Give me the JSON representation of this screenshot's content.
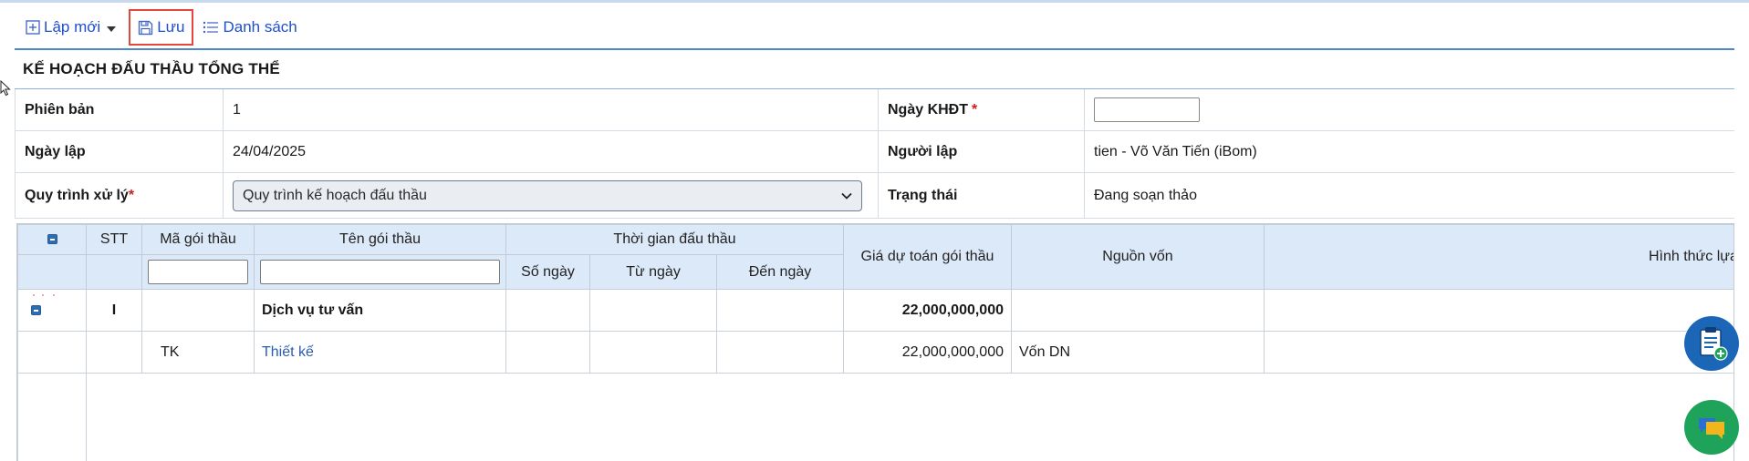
{
  "toolbar": {
    "new_label": "Lập mới",
    "save_label": "Lưu",
    "list_label": "Danh sách"
  },
  "page": {
    "title": "KẾ HOẠCH ĐẤU THẦU TỔNG THỂ"
  },
  "info": {
    "version_label": "Phiên bản",
    "version_value": "1",
    "plan_date_label": "Ngày KHĐT",
    "plan_date_value": "",
    "created_date_label": "Ngày lập",
    "created_date_value": "24/04/2025",
    "creator_label": "Người lập",
    "creator_value": "tien - Võ Văn Tiến (iBom)",
    "process_label": "Quy trình xử lý",
    "process_value": "Quy trình kế hoạch đấu thầu",
    "status_label": "Trạng thái",
    "status_value": "Đang soạn thảo",
    "required_mark": "*"
  },
  "table": {
    "headers": {
      "stt": "STT",
      "package_code": "Mã gói thầu",
      "package_name": "Tên gói thầu",
      "bidding_time": "Thời gian đấu thầu",
      "days": "Số ngày",
      "from_date": "Từ ngày",
      "to_date": "Đến ngày",
      "estimate": "Giá dự toán gói thầu",
      "capital_source": "Nguồn vốn",
      "selection_method": "Hình thức lựa chọn"
    },
    "rows": [
      {
        "stt": "I",
        "code": "",
        "name": "Dịch vụ tư vấn",
        "days": "",
        "from": "",
        "to": "",
        "estimate": "22,000,000,000",
        "source": "",
        "method": ""
      },
      {
        "stt": "",
        "code": "TK",
        "name": "Thiết kế",
        "days": "",
        "from": "",
        "to": "",
        "estimate": "22,000,000,000",
        "source": "Vốn DN",
        "method": ""
      }
    ]
  },
  "colors": {
    "accent": "#1f4fd0",
    "header_bg": "#dce9f8",
    "highlight_border": "#e4473d",
    "fab_blue": "#1c66b8",
    "fab_green": "#1fa35b"
  },
  "icons": [
    "plus-square-icon",
    "caret-down-icon",
    "save-icon",
    "list-icon",
    "chevron-down-icon",
    "collapse-icon",
    "clipboard-add-icon",
    "chat-icon",
    "mouse-cursor-icon"
  ]
}
